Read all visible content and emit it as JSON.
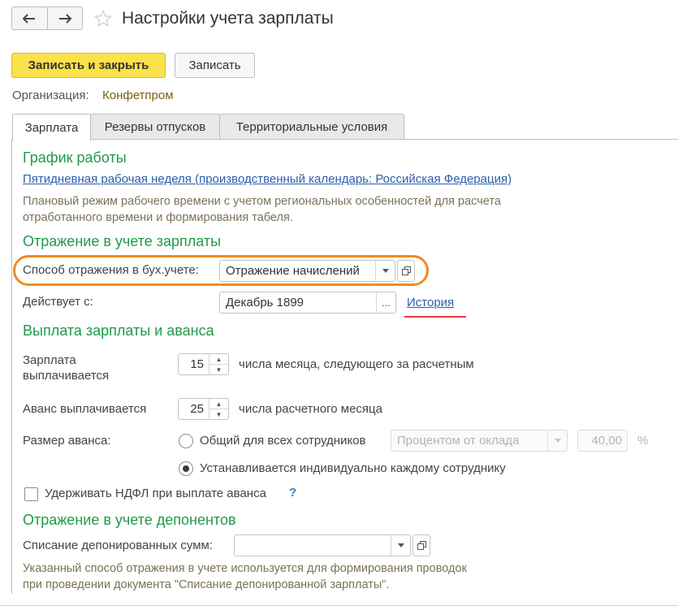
{
  "header": {
    "title": "Настройки учета зарплаты",
    "back_icon": "arrow-left-icon",
    "forward_icon": "arrow-right-icon",
    "favorite_icon": "star-icon"
  },
  "toolbar": {
    "save_close_label": "Записать и закрыть",
    "save_label": "Записать"
  },
  "organization": {
    "label": "Организация:",
    "value": "Конфетпром"
  },
  "tabs": [
    {
      "label": "Зарплата",
      "active": true
    },
    {
      "label": "Резервы отпусков",
      "active": false
    },
    {
      "label": "Территориальные условия",
      "active": false
    }
  ],
  "schedule": {
    "heading": "График работы",
    "link": "Пятидневная рабочая неделя (производственный календарь: Российская Федерация)",
    "note_line1": "Плановый режим рабочего времени с учетом региональных особенностей для расчета",
    "note_line2": "отработанного времени и формирования табеля."
  },
  "accounting": {
    "heading": "Отражение в учете зарплаты",
    "method_label": "Способ отражения в бух.учете:",
    "method_value": "Отражение начислений",
    "effective_label": "Действует с:",
    "effective_value": "Декабрь 1899",
    "choose_button": "...",
    "history_link": "История"
  },
  "payment": {
    "heading": "Выплата зарплаты и аванса",
    "salary_label_line1": "Зарплата",
    "salary_label_line2": "выплачивается",
    "salary_day": "15",
    "salary_suffix": "числа месяца, следующего за расчетным",
    "advance_label": "Аванс выплачивается",
    "advance_day": "25",
    "advance_suffix": "числа расчетного месяца",
    "advance_size_label": "Размер аванса:",
    "option_common": "Общий для всех сотрудников",
    "option_common_selected": false,
    "advance_mode": "Процентом от оклада",
    "advance_percent": "40,00",
    "percent_sign": "%",
    "option_individual": "Устанавливается индивидуально каждому сотруднику",
    "option_individual_selected": true,
    "ndfl_label": "Удерживать НДФЛ при выплате аванса",
    "ndfl_checked": false,
    "help_mark": "?"
  },
  "deponents": {
    "heading": "Отражение в учете депонентов",
    "writeoff_label": "Списание депонированных сумм:",
    "writeoff_value": "",
    "note_line1": "Указанный способ отражения в учете используется для формирования проводок",
    "note_line2": "при проведении документа \"Списание депонированной зарплаты\"."
  },
  "colors": {
    "primary_button": "#fbe14a",
    "section_heading": "#1f9a4a",
    "link": "#2d5dae",
    "highlight_oval": "#f08a24",
    "history_underline": "#e0403a"
  }
}
